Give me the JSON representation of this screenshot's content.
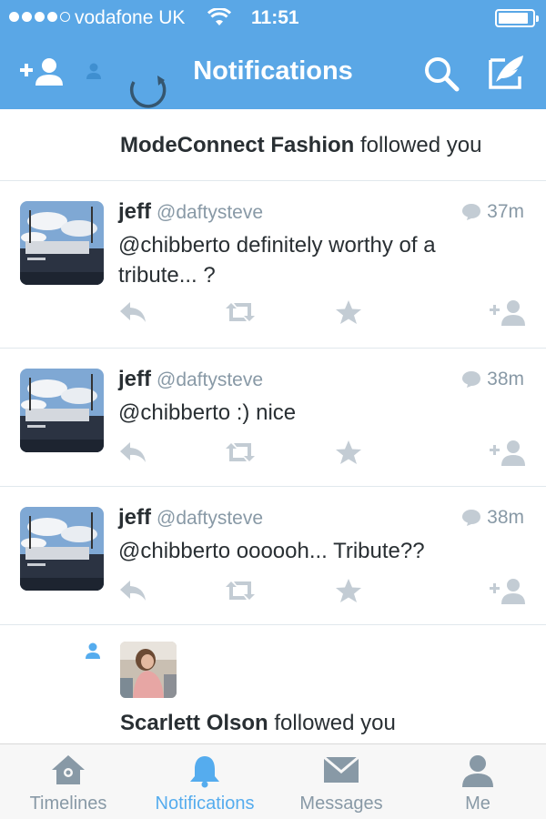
{
  "status_bar": {
    "carrier": "vodafone UK",
    "time": "11:51"
  },
  "nav": {
    "title": "Notifications"
  },
  "colors": {
    "accent": "#5aa7e6",
    "link_blue": "#55acee",
    "grey_text": "#8899a6",
    "icon_grey": "#c3ccd4"
  },
  "notifications": {
    "top_follow": {
      "name": "ModeConnect Fashion",
      "action": "followed you"
    },
    "tweets": [
      {
        "name": "jeff",
        "handle": "@daftysteve",
        "time": "37m",
        "text": "@chibberto definitely worthy of a tribute... ?"
      },
      {
        "name": "jeff",
        "handle": "@daftysteve",
        "time": "38m",
        "text": "@chibberto :) nice"
      },
      {
        "name": "jeff",
        "handle": "@daftysteve",
        "time": "38m",
        "text": "@chibberto oooooh... Tribute??"
      }
    ],
    "bottom_follow": {
      "name": "Scarlett Olson",
      "action": "followed you"
    }
  },
  "icons": {
    "reply": "reply-icon",
    "retweet": "retweet-icon",
    "favorite": "star-icon",
    "follow": "add-user-icon",
    "conversation": "speech-bubble-icon"
  },
  "tabbar": {
    "items": [
      {
        "label": "Timelines",
        "icon": "home-icon",
        "active": false
      },
      {
        "label": "Notifications",
        "icon": "bell-icon",
        "active": true
      },
      {
        "label": "Messages",
        "icon": "envelope-icon",
        "active": false
      },
      {
        "label": "Me",
        "icon": "person-icon",
        "active": false
      }
    ]
  }
}
